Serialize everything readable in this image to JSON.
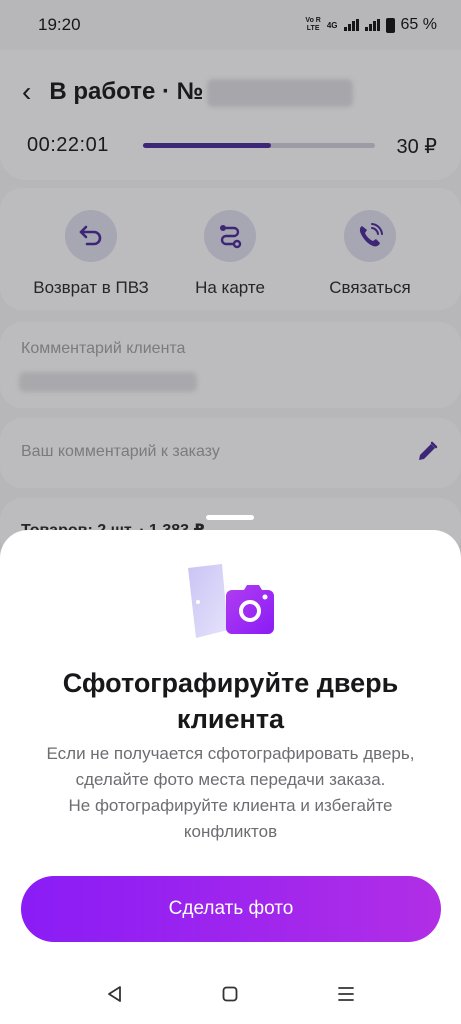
{
  "status_bar": {
    "time": "19:20",
    "volte": "Vo R\nLTE",
    "network": "4G",
    "battery": "65 %"
  },
  "header": {
    "title": "В работе · №",
    "timer": "00:22:01",
    "progress_fraction": 0.55,
    "price": "30 ₽"
  },
  "actions": [
    {
      "label": "Возврат в ПВЗ",
      "icon": "return-arrow-icon"
    },
    {
      "label": "На карте",
      "icon": "route-icon"
    },
    {
      "label": "Связаться",
      "icon": "phone-call-icon"
    }
  ],
  "client_comment": {
    "label": "Комментарий клиента"
  },
  "my_comment": {
    "placeholder": "Ваш комментарий к заказу",
    "icon": "pencil-icon"
  },
  "goods": {
    "summary": "Товаров: 2 шт. · 1 383 ₽"
  },
  "sheet": {
    "title": "Сфотографируйте дверь клиента",
    "description_lines": [
      "Если не получается сфотографировать дверь,",
      "сделайте фото места передачи заказа.",
      "Не фотографируйте клиента и избегайте",
      "конфликтов"
    ],
    "button_label": "Сделать фото",
    "illustration": "door-camera-icon"
  },
  "colors": {
    "accent": "#8a1cf6",
    "accent_end": "#b12ee6",
    "accent_icon": "#3d2676"
  },
  "nav": [
    "back-triangle-icon",
    "home-square-icon",
    "menu-lines-icon"
  ]
}
